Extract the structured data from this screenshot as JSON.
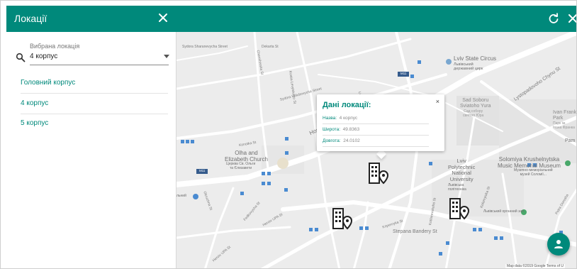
{
  "sidebar": {
    "title": "Локації",
    "field_label": "Вибрана локація",
    "field_value": "4 корпус",
    "items": [
      {
        "label": "Головний корпус"
      },
      {
        "label": "4 корпус"
      },
      {
        "label": "5 корпус"
      }
    ]
  },
  "map": {
    "streets": {
      "s1": "Sydora Sharanevycha Street",
      "s2": "Dekarta St",
      "s3": "Chernihivska St",
      "s4": "Kostia Levytskoho St",
      "s5": "Sydora Holubovycha Street",
      "s6": "Horodotska",
      "s7": "Konotka St",
      "s8": "Petra Dorosha",
      "s9": "Heroiv UPA St",
      "s10": "Heroiv UPA St",
      "s11": "Stepana Bandery St",
      "s12": "Lystopadovoho Chynu St",
      "s13": "Kopernyka St",
      "s14": "Kotliarevskoho St",
      "s15": "Fedkovycha St",
      "s16": "Okruzhna St",
      "s17": "Kolomyiska St",
      "s18": "Lva"
    },
    "highway_badge": "M11",
    "places": {
      "circus": "Lviv State Circus",
      "circus_ua": "Львівський\nдержавний цирк",
      "church_en": "Olha and\nElizabeth Church",
      "church_ua": "Церква Св. Ольги\nта Єлизавети",
      "sobor": "Sad Soboru\nSviatoho Yura",
      "sobor_ua": "Сад собору\nсвятого Юра",
      "park": "Ivan Franko\nPark",
      "park_ua": "Парк ім.\nІвана Франка",
      "museum": "Solomiya Krushelnytska\nMusic Memorial Museum",
      "museum_ua": "Музично-меморіальний\nмузей Соломії...",
      "poly": "Lviv\nPolytechnic\nNational\nUniversity",
      "poly_ua": "Львівська\nполітехніка",
      "organ": "Львівський органний зал",
      "pam": "Pam",
      "shopping": "льний"
    },
    "attribution": "Map data ©2019 Google   Terms of U"
  },
  "popup": {
    "title": "Дані локації:",
    "close": "×",
    "rows": [
      {
        "key": "Назва:",
        "value": "4 корпус"
      },
      {
        "key": "Широта:",
        "value": "49.8363"
      },
      {
        "key": "Довгота:",
        "value": "24.0102"
      }
    ]
  },
  "colors": {
    "accent": "#00897b",
    "map_bg": "#ececec",
    "road": "#ffffff"
  }
}
